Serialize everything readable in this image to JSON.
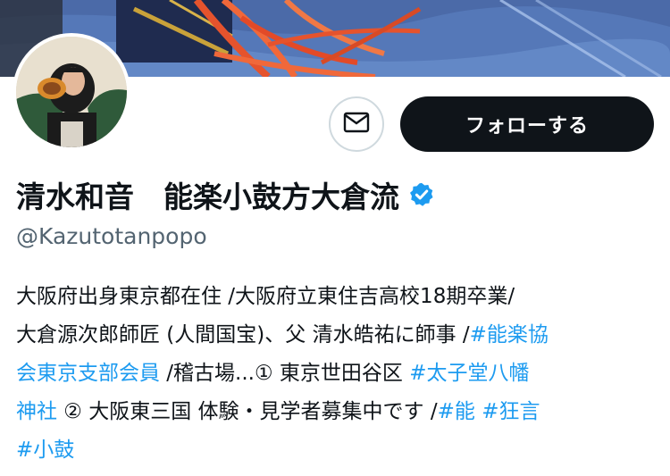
{
  "profile": {
    "display_name": "清水和音　能楽小鼓方大倉流",
    "handle": "@Kazutotanpopo",
    "verified": true,
    "verified_icon": "verified-badge-icon",
    "message_icon": "envelope-icon"
  },
  "actions": {
    "follow_label": "フォローする"
  },
  "bio": {
    "line1": {
      "text": "大阪府出身東京都在住 /大阪府立東住吉高校18期卒業/"
    },
    "line2": {
      "text": "大倉源次郎師匠 (人間国宝)、父 清水皓祐に師事 /",
      "tag": "#能楽協"
    },
    "line3": {
      "tag": "会東京支部会員",
      "text1": " /稽古場...① 東京世田谷区 ",
      "tag2": "#太子堂八幡"
    },
    "line4": {
      "tag": "神社",
      "text1": " ② 大阪東三国 体験・見学者募集中です /",
      "tag2": "#能",
      "space": " ",
      "tag3": "#狂言"
    },
    "line5": {
      "tag": "#小鼓"
    }
  },
  "colors": {
    "link": "#1d9bf0",
    "text": "#0f1419",
    "secondary": "#536471",
    "follow_bg": "#0f1419",
    "verified": "#1d9bf0"
  }
}
